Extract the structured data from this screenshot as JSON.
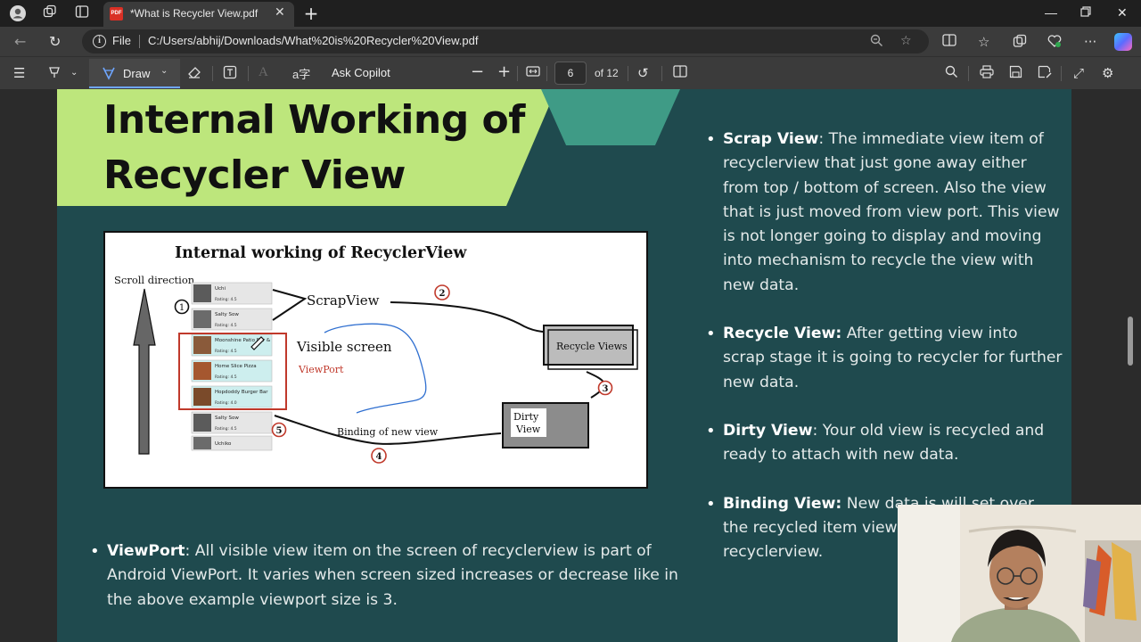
{
  "browser": {
    "tab_title": "*What is Recycler View.pdf",
    "tab_favicon": "PDF",
    "file_label": "File",
    "url": "C:/Users/abhij/Downloads/What%20is%20Recycler%20View.pdf"
  },
  "pdf_toolbar": {
    "draw_label": "Draw",
    "ask_copilot_label": "Ask Copilot",
    "page_number": "6",
    "page_total": "of 12"
  },
  "slide": {
    "title": "Internal Working of Recycler View",
    "right_bullets": [
      {
        "term": "Scrap View",
        "text": ": The immediate view item of recyclerview that just gone away either from top / bottom of screen. Also the view that is just moved from view port. This view is not longer going to display and moving into mechanism to recycle the view with new data."
      },
      {
        "term": "Recycle View:",
        "text": " After getting view into scrap stage it is going to recycler for further new data."
      },
      {
        "term": "Dirty View",
        "text": ": Your old view is recycled and ready to attach with new data."
      },
      {
        "term": "Binding View:",
        "text": " New data is will set over the recycled item view and then visible into recyclerview."
      }
    ],
    "left_bullet": {
      "term": "ViewPort",
      "text": ": All visible view item on the screen of recyclerview is part of Android ViewPort. It varies when screen sized increases or decrease like in the above example viewport size is 3."
    }
  },
  "diagram": {
    "title": "Internal working of RecyclerView",
    "scroll_label": "Scroll direction",
    "scrap_label": "ScrapView",
    "visible_label": "Visible screen",
    "viewport_label": "ViewPort",
    "recycle_label": "Recycle Views",
    "dirty_label_1": "Dirty",
    "dirty_label_2": "View",
    "binding_label": "Binding of new view",
    "steps": [
      "1",
      "2",
      "3",
      "4",
      "5"
    ],
    "list_items": [
      {
        "name": "Uchi",
        "rating": "Rating: 4.5"
      },
      {
        "name": "Salty Sow",
        "rating": "Rating: 4.5"
      },
      {
        "name": "Moonshine Patio Bar &",
        "rating": "Rating: 4.5"
      },
      {
        "name": "Home Slice Pizza",
        "rating": "Rating: 4.5"
      },
      {
        "name": "Hopdoddy Burger Bar",
        "rating": "Rating: 4.0"
      },
      {
        "name": "Salty Sow",
        "rating": "Rating: 4.5"
      },
      {
        "name": "Uchiko",
        "rating": ""
      }
    ]
  },
  "colors": {
    "slide_bg": "#1f4a4e",
    "banner": "#bde67c",
    "hex_accent": "#3f9b86",
    "viewport_red": "#c0392b",
    "annotation_blue": "#2f6fd0"
  }
}
